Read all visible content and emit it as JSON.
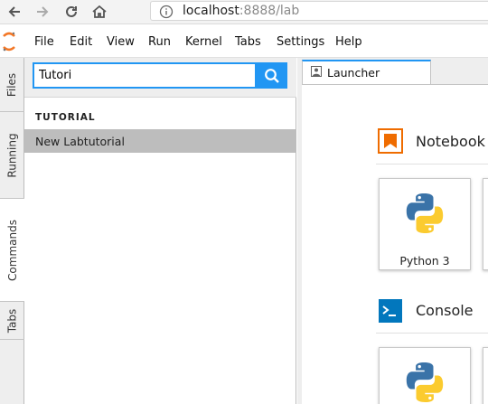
{
  "browser": {
    "url_host": "localhost",
    "url_rest": ":8888/lab"
  },
  "menu": {
    "items": [
      {
        "label": "File"
      },
      {
        "label": "Edit"
      },
      {
        "label": "View"
      },
      {
        "label": "Run"
      },
      {
        "label": "Kernel"
      },
      {
        "label": "Tabs"
      },
      {
        "label": "Settings"
      },
      {
        "label": "Help"
      }
    ]
  },
  "sidebar": {
    "tabs": [
      {
        "label": "Files",
        "active": false
      },
      {
        "label": "Running",
        "active": false
      },
      {
        "label": "Commands",
        "active": true
      },
      {
        "label": "Tabs",
        "active": false
      }
    ]
  },
  "commands": {
    "search_value": "Tutori",
    "category": "TUTORIAL",
    "results": [
      {
        "label": "New Labtutorial"
      }
    ]
  },
  "launcher": {
    "tab_label": "Launcher",
    "sections": [
      {
        "title": "Notebook",
        "icon": "notebook-icon",
        "cards": [
          {
            "label": "Python 3"
          }
        ]
      },
      {
        "title": "Console",
        "icon": "console-icon",
        "cards": [
          {
            "label": ""
          }
        ]
      }
    ]
  },
  "colors": {
    "accent": "#2196f3",
    "notebook_orange": "#ef6c00",
    "console_blue": "#0277bd",
    "selected_row": "#bdbdbd"
  }
}
